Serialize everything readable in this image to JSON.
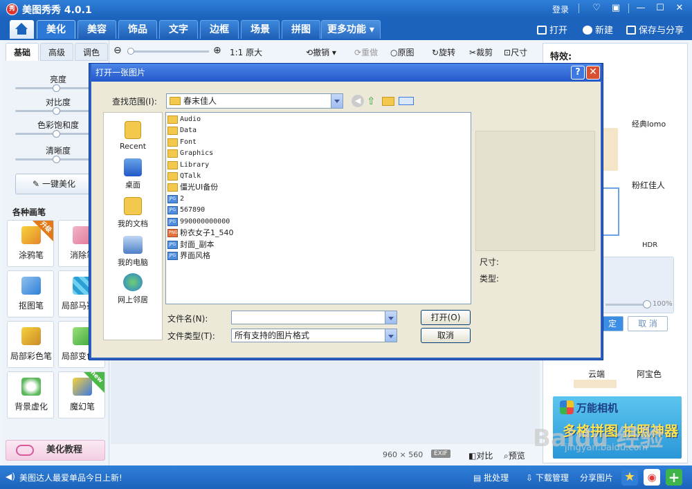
{
  "app": {
    "title": "美图秀秀 4.0.1",
    "logo_char": "秀",
    "login": "登录"
  },
  "main_tabs": [
    "美化",
    "美容",
    "饰品",
    "文字",
    "边框",
    "场景",
    "拼图",
    "更多功能"
  ],
  "main_tabs_active": "美化",
  "toolbar_right": {
    "open": "打开",
    "new": "新建",
    "save_share": "保存与分享"
  },
  "sub_tabs": [
    "基础",
    "高级",
    "调色"
  ],
  "sliders": [
    "亮度",
    "对比度",
    "色彩饱和度",
    "清晰度"
  ],
  "one_key": "一键美化",
  "brush_section": "各种画笔",
  "tools": [
    {
      "label": "涂鸦笔",
      "badge": "升级"
    },
    {
      "label": "消除笔",
      "badge": ""
    },
    {
      "label": "抠图笔",
      "badge": ""
    },
    {
      "label": "局部马赛克",
      "badge": ""
    },
    {
      "label": "局部彩色笔",
      "badge": ""
    },
    {
      "label": "局部变色笔",
      "badge": ""
    },
    {
      "label": "背景虚化",
      "badge": ""
    },
    {
      "label": "魔幻笔",
      "badge": "new"
    }
  ],
  "tutorial": "美化教程",
  "canvas_toolbar": {
    "original_size": "1:1 原大",
    "undo": "撤销",
    "redo": "重做",
    "original": "原图",
    "rotate": "旋转",
    "crop": "裁剪",
    "size": "尺寸"
  },
  "canvas_footer": {
    "dimensions": "960 × 560",
    "exif": "EXIF",
    "compare": "对比",
    "preview": "预览"
  },
  "right_panel": {
    "title": "特效:",
    "items": [
      "经典lomo",
      "粉红佳人",
      "HDR",
      "云端",
      "阿宝色"
    ],
    "opacity": "100%",
    "confirm": "定",
    "cancel": "取 消"
  },
  "ad": {
    "title": "万能相机",
    "subtitle": "多格拼图 拍照神器"
  },
  "status_bar": {
    "message": "美图达人最爱单品今日上新!",
    "batch": "批处理",
    "download": "下载管理",
    "share": "分享图片"
  },
  "dialog": {
    "title": "打开一张图片",
    "look_in_label": "查找范围(I):",
    "look_in_value": "春末佳人",
    "places": [
      "Recent",
      "桌面",
      "我的文档",
      "我的电脑",
      "网上邻居"
    ],
    "files": [
      {
        "name": "Audio",
        "type": "folder"
      },
      {
        "name": "Data",
        "type": "folder"
      },
      {
        "name": "Font",
        "type": "folder"
      },
      {
        "name": "Graphics",
        "type": "folder"
      },
      {
        "name": "Library",
        "type": "folder"
      },
      {
        "name": "QTalk",
        "type": "folder"
      },
      {
        "name": "僵光UI备份",
        "type": "folder"
      },
      {
        "name": "2",
        "type": "jpg"
      },
      {
        "name": "567890",
        "type": "jpg"
      },
      {
        "name": "990000000000",
        "type": "jpg"
      },
      {
        "name": "粉衣女子1_540",
        "type": "png"
      },
      {
        "name": "封面_副本",
        "type": "jpg"
      },
      {
        "name": "界面风格",
        "type": "jpg"
      }
    ],
    "size_label": "尺寸:",
    "type_label": "类型:",
    "filename_label": "文件名(N):",
    "filename_value": "",
    "filetype_label": "文件类型(T):",
    "filetype_value": "所有支持的图片格式",
    "open_button": "打开(O)",
    "cancel_button": "取消"
  },
  "watermark": {
    "logo": "Baidu 经验",
    "url": "jingyan.baidu.com"
  }
}
